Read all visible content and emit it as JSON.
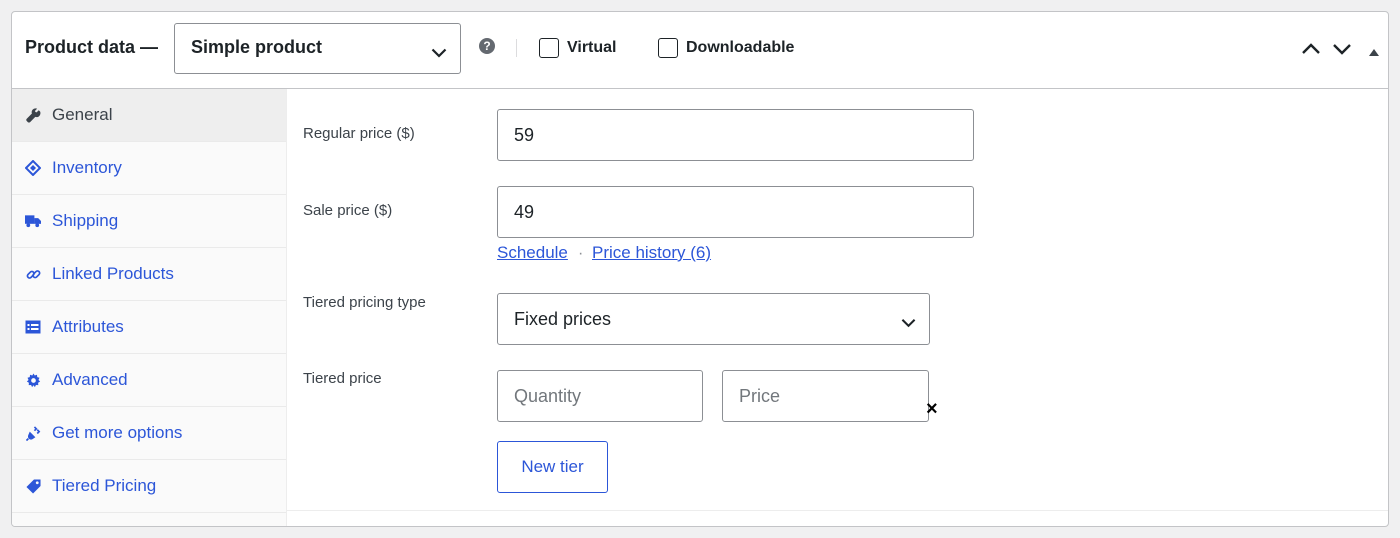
{
  "header": {
    "title": "Product data —",
    "product_type": "Simple product",
    "help": "?",
    "virtual_label": "Virtual",
    "downloadable_label": "Downloadable"
  },
  "sidebar": {
    "items": [
      {
        "label": "General",
        "icon": "wrench-icon",
        "active": true
      },
      {
        "label": "Inventory",
        "icon": "tag-icon"
      },
      {
        "label": "Shipping",
        "icon": "truck-icon"
      },
      {
        "label": "Linked Products",
        "icon": "link-icon"
      },
      {
        "label": "Attributes",
        "icon": "list-icon"
      },
      {
        "label": "Advanced",
        "icon": "gear-icon"
      },
      {
        "label": "Get more options",
        "icon": "plugin-icon"
      },
      {
        "label": "Tiered Pricing",
        "icon": "price-tag-icon"
      }
    ]
  },
  "general": {
    "regular_price_label": "Regular price ($)",
    "regular_price_value": "59",
    "sale_price_label": "Sale price ($)",
    "sale_price_value": "49",
    "schedule_link": "Schedule",
    "separator": "·",
    "price_history_link": "Price history (6)",
    "tiered_type_label": "Tiered pricing type",
    "tiered_type_value": "Fixed prices",
    "tiered_price_label": "Tiered price",
    "quantity_placeholder": "Quantity",
    "price_placeholder": "Price",
    "remove_symbol": "×",
    "new_tier_label": "New tier"
  },
  "colors": {
    "link": "#2c56d8",
    "border": "#8c8f94",
    "active_tab_bg": "#eeeeee"
  }
}
